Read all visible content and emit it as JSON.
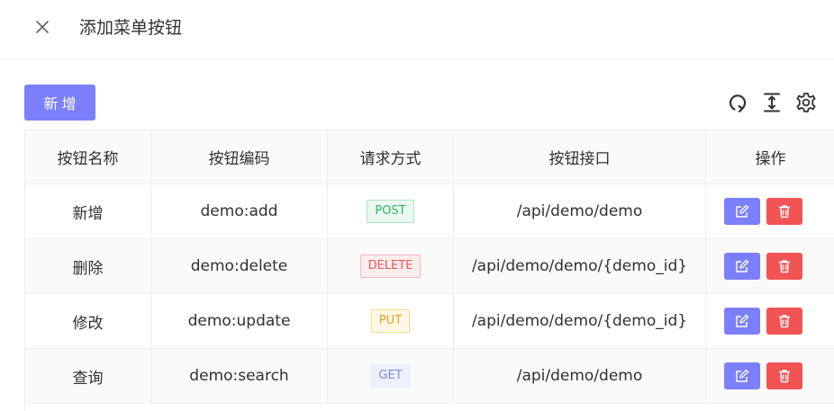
{
  "dialog": {
    "title": "添加菜单按钮"
  },
  "toolbar": {
    "add_label": "新增",
    "icons": [
      "refresh-icon",
      "column-height-icon",
      "settings-icon"
    ]
  },
  "table": {
    "columns": [
      "按钮名称",
      "按钮编码",
      "请求方式",
      "按钮接口",
      "操作"
    ],
    "rows": [
      {
        "name": "新增",
        "code": "demo:add",
        "method": "POST",
        "api": "/api/demo/demo"
      },
      {
        "name": "删除",
        "code": "demo:delete",
        "method": "DELETE",
        "api": "/api/demo/demo/{demo_id}"
      },
      {
        "name": "修改",
        "code": "demo:update",
        "method": "PUT",
        "api": "/api/demo/demo/{demo_id}"
      },
      {
        "name": "查询",
        "code": "demo:search",
        "method": "GET",
        "api": "/api/demo/demo"
      }
    ]
  },
  "colors": {
    "primary": "#7b7ffb",
    "danger": "#f25353",
    "post": "#2fb861",
    "delete": "#f0545a",
    "put": "#e5a326",
    "get": "#7e8ae0"
  }
}
